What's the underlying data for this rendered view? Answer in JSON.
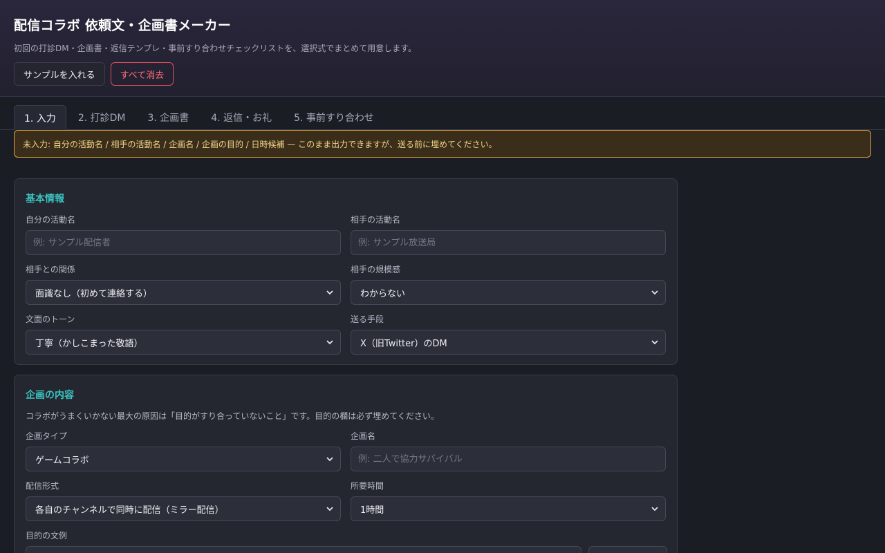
{
  "header": {
    "title": "配信コラボ 依頼文・企画書メーカー",
    "subtitle": "初回の打診DM・企画書・返信テンプレ・事前すり合わせチェックリストを、選択式でまとめて用意します。",
    "sample_button": "サンプルを入れる",
    "clear_button": "すべて消去"
  },
  "tabs": [
    {
      "label": "1. 入力",
      "active": true
    },
    {
      "label": "2. 打診DM",
      "active": false
    },
    {
      "label": "3. 企画書",
      "active": false
    },
    {
      "label": "4. 返信・お礼",
      "active": false
    },
    {
      "label": "5. 事前すり合わせ",
      "active": false
    }
  ],
  "warning": "未入力: 自分の活動名 / 相手の活動名 / 企画名 / 企画の目的 / 日時候補 — このまま出力できますが、送る前に埋めてください。",
  "basic": {
    "title": "基本情報",
    "self_name": {
      "label": "自分の活動名",
      "value": "",
      "placeholder": "例: サンプル配信者"
    },
    "partner_name": {
      "label": "相手の活動名",
      "value": "",
      "placeholder": "例: サンプル放送局"
    },
    "relation": {
      "label": "相手との関係",
      "value": "面識なし（初めて連絡する）"
    },
    "scale": {
      "label": "相手の規模感",
      "value": "わからない"
    },
    "tone": {
      "label": "文面のトーン",
      "value": "丁寧（かしこまった敬語）"
    },
    "channel": {
      "label": "送る手段",
      "value": "X（旧Twitter）のDM"
    }
  },
  "plan": {
    "title": "企画の内容",
    "note": "コラボがうまくいかない最大の原因は「目的がすり合っていないこと」です。目的の欄は必ず埋めてください。",
    "type": {
      "label": "企画タイプ",
      "value": "ゲームコラボ"
    },
    "name": {
      "label": "企画名",
      "value": "",
      "placeholder": "例: 二人で協力サバイバル"
    },
    "format": {
      "label": "配信形式",
      "value": "各自のチャンネルで同時に配信（ミラー配信）"
    },
    "duration": {
      "label": "所要時間",
      "value": "1時間"
    },
    "purpose_label": "目的の文例"
  },
  "colors": {
    "accent": "#3cc3c0",
    "warning_border": "#d9a441",
    "danger": "#e0505f"
  }
}
